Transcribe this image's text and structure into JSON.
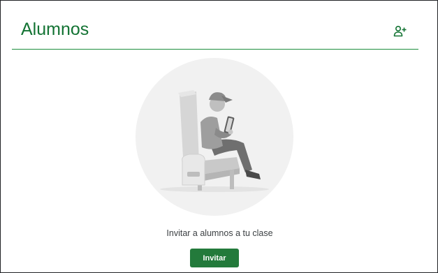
{
  "header": {
    "title": "Alumnos",
    "add_icon": "person-add-icon"
  },
  "empty_state": {
    "illustration": "student-reading-tablet-illustration",
    "message": "Invitar a alumnos a tu clase",
    "invite_label": "Invitar"
  },
  "colors": {
    "accent": "#137333",
    "button": "#237a3b",
    "divider": "#1e8e3e",
    "text": "#3c4043"
  }
}
